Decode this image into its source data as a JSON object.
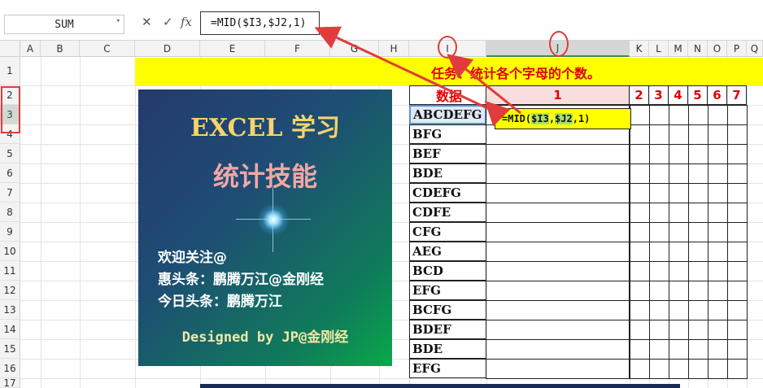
{
  "formula_bar": {
    "name_box": "SUM",
    "cancel_icon": "✕",
    "enter_icon": "✓",
    "fx_icon": "fx",
    "formula": "=MID($I3,$J2,1)"
  },
  "columns": [
    "A",
    "B",
    "C",
    "D",
    "E",
    "F",
    "G",
    "H",
    "I",
    "J",
    "K",
    "L",
    "M",
    "N",
    "O",
    "P",
    "Q"
  ],
  "rows": [
    "1",
    "2",
    "3",
    "4",
    "5",
    "6",
    "7",
    "8",
    "9",
    "10",
    "11",
    "12",
    "13",
    "14",
    "15",
    "16",
    "17"
  ],
  "task_banner": "任务：统计各个字母的个数。",
  "table": {
    "header": "数据",
    "num_headers": [
      "1",
      "2",
      "3",
      "4",
      "5",
      "6",
      "7"
    ],
    "data": [
      "ABCDEFG",
      "BFG",
      "BEF",
      "BDE",
      "CDEFG",
      "CDFE",
      "CFG",
      "AEG",
      "BCD",
      "EFG",
      "BCFG",
      "BDEF",
      "BDE",
      "EFG"
    ]
  },
  "floating_formula": {
    "pre": "=MID(",
    "ref1": "$I3",
    "mid": ",",
    "ref2": "$J2",
    "post": ",1)"
  },
  "promo": {
    "title": "EXCEL 学习",
    "subtitle": "统计技能",
    "line1": "欢迎关注@",
    "line2": "惠头条：鹏腾万江@金刚经",
    "line3": "今日头条：鹏腾万江",
    "signature": "Designed by JP@金刚经"
  }
}
